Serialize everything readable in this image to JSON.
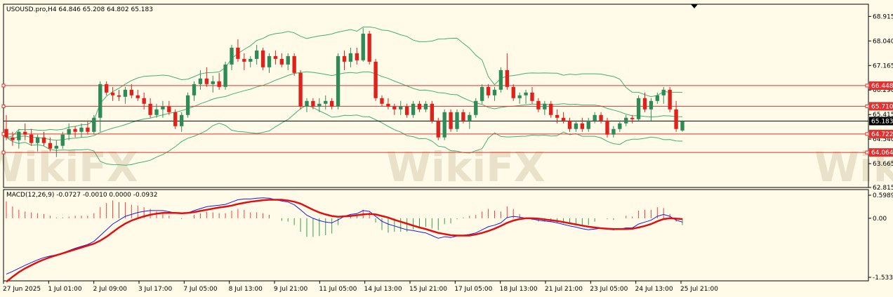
{
  "chart_header": {
    "title": "USOUSD.pro,H4  64.846 65.208 64.802 65.183",
    "macd_title": "MACD(12,26,9) -0.0727 -0.0010 0.0000 -0.0932"
  },
  "watermark": "WikiFX",
  "colors": {
    "background": "#fffbe8",
    "bull": "#2e8b57",
    "bear": "#e0201a",
    "band": "#3cb371",
    "level": "#e03030",
    "macd_line": "#1a1ad8",
    "signal_line": "#e01010",
    "histogram": "#ff3b3b",
    "histogram_neg": "#2ea04a",
    "grid": "#000000"
  },
  "chart_data": [
    {
      "type": "candlestick",
      "title": "USOUSD.pro,H4",
      "y_ticks": [
        "68.915",
        "68.040",
        "67.165",
        "66.290",
        "65.415",
        "64.540",
        "63.665",
        "62.815"
      ],
      "ylim": [
        62.815,
        69.35
      ],
      "x_ticks": [
        "27 Jun 2025",
        "1 Jul 01:00",
        "2 Jul 09:00",
        "3 Jul 17:00",
        "7 Jul 05:00",
        "8 Jul 13:00",
        "9 Jul 21:00",
        "11 Jul 05:00",
        "14 Jul 13:00",
        "15 Jul 21:00",
        "17 Jul 05:00",
        "18 Jul 13:00",
        "21 Jul 21:00",
        "23 Jul 05:00",
        "24 Jul 13:00",
        "25 Jul 21:00"
      ],
      "price_labels": [
        {
          "value": 66.448,
          "label": "66.448",
          "style": "level"
        },
        {
          "value": 65.71,
          "label": "65.710",
          "style": "level"
        },
        {
          "value": 65.183,
          "label": "65.183",
          "style": "current"
        },
        {
          "value": 64.722,
          "label": "64.722",
          "style": "level"
        },
        {
          "value": 64.064,
          "label": "64.064",
          "style": "level"
        }
      ],
      "candles": [
        [
          64.9,
          65.4,
          64.5,
          64.6
        ],
        [
          64.6,
          64.8,
          64.3,
          64.5
        ],
        [
          64.5,
          64.9,
          64.2,
          64.8
        ],
        [
          64.8,
          65.1,
          64.5,
          64.7
        ],
        [
          64.7,
          64.9,
          64.3,
          64.4
        ],
        [
          64.4,
          64.7,
          64.1,
          64.6
        ],
        [
          64.6,
          64.8,
          64.3,
          64.4
        ],
        [
          64.4,
          64.6,
          64.1,
          64.2
        ],
        [
          64.2,
          64.5,
          63.9,
          64.3
        ],
        [
          64.3,
          64.8,
          64.2,
          64.7
        ],
        [
          64.7,
          65.1,
          64.5,
          64.9
        ],
        [
          64.9,
          65.0,
          64.6,
          64.8
        ],
        [
          64.8,
          65.1,
          64.6,
          64.95
        ],
        [
          64.95,
          65.2,
          64.7,
          64.8
        ],
        [
          64.8,
          65.4,
          64.7,
          65.3
        ],
        [
          65.3,
          66.6,
          64.8,
          66.5
        ],
        [
          66.5,
          66.6,
          66.1,
          66.2
        ],
        [
          66.2,
          66.4,
          65.9,
          66.1
        ],
        [
          66.1,
          66.3,
          65.9,
          66.05
        ],
        [
          66.05,
          66.4,
          65.8,
          66.3
        ],
        [
          66.3,
          66.5,
          66.0,
          66.1
        ],
        [
          66.1,
          66.3,
          65.9,
          66.0
        ],
        [
          66.0,
          66.2,
          65.6,
          65.8
        ],
        [
          65.8,
          66.0,
          65.3,
          65.4
        ],
        [
          65.4,
          65.8,
          65.3,
          65.6
        ],
        [
          65.6,
          65.9,
          65.3,
          65.7
        ],
        [
          65.7,
          65.9,
          65.4,
          65.5
        ],
        [
          65.5,
          65.6,
          64.9,
          65.0
        ],
        [
          65.0,
          65.5,
          64.8,
          65.4
        ],
        [
          65.4,
          66.2,
          65.3,
          66.1
        ],
        [
          66.1,
          66.6,
          65.9,
          66.5
        ],
        [
          66.5,
          67.0,
          66.3,
          66.7
        ],
        [
          66.7,
          67.1,
          66.4,
          66.5
        ],
        [
          66.5,
          66.8,
          66.2,
          66.6
        ],
        [
          66.6,
          66.9,
          66.3,
          66.4
        ],
        [
          66.4,
          67.3,
          66.3,
          67.2
        ],
        [
          67.2,
          67.9,
          67.0,
          67.8
        ],
        [
          67.8,
          68.1,
          67.3,
          67.4
        ],
        [
          67.4,
          67.6,
          67.0,
          67.3
        ],
        [
          67.3,
          67.5,
          67.1,
          67.4
        ],
        [
          67.4,
          67.9,
          67.2,
          67.7
        ],
        [
          67.7,
          67.8,
          67.0,
          67.1
        ],
        [
          67.1,
          67.6,
          66.9,
          67.5
        ],
        [
          67.5,
          67.7,
          67.2,
          67.4
        ],
        [
          67.4,
          67.6,
          67.1,
          67.2
        ],
        [
          67.2,
          67.6,
          67.0,
          67.5
        ],
        [
          67.5,
          67.6,
          66.8,
          66.9
        ],
        [
          66.9,
          67.0,
          65.6,
          65.7
        ],
        [
          65.7,
          66.0,
          65.5,
          65.9
        ],
        [
          65.9,
          66.0,
          65.6,
          65.7
        ],
        [
          65.7,
          66.0,
          65.5,
          65.8
        ],
        [
          65.8,
          66.1,
          65.6,
          65.9
        ],
        [
          65.9,
          66.0,
          65.6,
          65.7
        ],
        [
          65.7,
          67.6,
          65.6,
          67.5
        ],
        [
          67.5,
          67.7,
          67.0,
          67.3
        ],
        [
          67.3,
          67.8,
          67.1,
          67.6
        ],
        [
          67.6,
          67.8,
          67.2,
          67.35
        ],
        [
          67.35,
          68.5,
          67.3,
          68.3
        ],
        [
          68.3,
          68.4,
          67.2,
          67.3
        ],
        [
          67.3,
          67.4,
          65.9,
          66.0
        ],
        [
          66.0,
          66.1,
          65.7,
          65.8
        ],
        [
          65.8,
          66.0,
          65.6,
          65.7
        ],
        [
          65.7,
          65.8,
          65.4,
          65.6
        ],
        [
          65.6,
          65.9,
          65.4,
          65.7
        ],
        [
          65.7,
          65.8,
          65.3,
          65.4
        ],
        [
          65.4,
          65.9,
          65.3,
          65.8
        ],
        [
          65.8,
          65.9,
          65.5,
          65.6
        ],
        [
          65.6,
          65.9,
          65.5,
          65.8
        ],
        [
          65.8,
          65.9,
          65.1,
          65.2
        ],
        [
          65.2,
          65.3,
          64.5,
          64.6
        ],
        [
          64.6,
          65.6,
          64.5,
          65.5
        ],
        [
          65.5,
          65.6,
          64.8,
          64.9
        ],
        [
          64.9,
          65.6,
          64.8,
          65.5
        ],
        [
          65.5,
          65.6,
          65.1,
          65.2
        ],
        [
          65.2,
          65.5,
          64.9,
          65.4
        ],
        [
          65.4,
          66.0,
          65.3,
          65.9
        ],
        [
          65.9,
          66.5,
          65.8,
          66.4
        ],
        [
          66.4,
          66.5,
          66.0,
          66.1
        ],
        [
          66.1,
          66.4,
          65.9,
          66.3
        ],
        [
          66.3,
          67.1,
          66.2,
          67.0
        ],
        [
          67.0,
          67.6,
          66.3,
          66.4
        ],
        [
          66.4,
          66.5,
          65.9,
          66.0
        ],
        [
          66.0,
          66.2,
          65.8,
          66.1
        ],
        [
          66.1,
          66.3,
          65.8,
          66.2
        ],
        [
          66.2,
          66.4,
          65.8,
          65.9
        ],
        [
          65.9,
          66.0,
          65.5,
          65.6
        ],
        [
          65.6,
          65.9,
          65.4,
          65.8
        ],
        [
          65.8,
          65.9,
          65.3,
          65.4
        ],
        [
          65.4,
          65.6,
          65.1,
          65.3
        ],
        [
          65.3,
          65.5,
          65.1,
          65.2
        ],
        [
          65.2,
          65.3,
          64.8,
          64.9
        ],
        [
          64.9,
          65.2,
          64.8,
          65.1
        ],
        [
          65.1,
          65.3,
          64.8,
          64.9
        ],
        [
          64.9,
          65.3,
          64.8,
          65.2
        ],
        [
          65.2,
          65.5,
          65.1,
          65.4
        ],
        [
          65.4,
          65.5,
          65.1,
          65.2
        ],
        [
          65.2,
          65.3,
          64.6,
          64.7
        ],
        [
          64.7,
          65.0,
          64.6,
          64.9
        ],
        [
          64.9,
          65.2,
          64.8,
          65.1
        ],
        [
          65.1,
          65.4,
          65.0,
          65.3
        ],
        [
          65.3,
          65.4,
          65.1,
          65.25
        ],
        [
          65.25,
          66.1,
          65.2,
          66.0
        ],
        [
          66.0,
          66.2,
          65.5,
          65.6
        ],
        [
          65.6,
          66.0,
          65.2,
          65.9
        ],
        [
          65.9,
          66.2,
          65.8,
          66.1
        ],
        [
          66.1,
          66.4,
          65.8,
          66.3
        ],
        [
          66.3,
          66.4,
          65.5,
          65.6
        ],
        [
          65.6,
          65.9,
          64.8,
          64.9
        ],
        [
          64.846,
          65.208,
          64.802,
          65.183
        ]
      ]
    },
    {
      "type": "macd",
      "title": "MACD(12,26,9)",
      "y_ticks": [
        "0.5989",
        "0.00",
        "-1.5338"
      ],
      "ylim": [
        -1.5338,
        0.5989
      ],
      "macd": [
        -1.45,
        -1.38,
        -1.3,
        -1.22,
        -1.15,
        -1.08,
        -1.02,
        -0.98,
        -0.95,
        -0.9,
        -0.84,
        -0.78,
        -0.73,
        -0.68,
        -0.6,
        -0.45,
        -0.3,
        -0.15,
        -0.05,
        0.05,
        0.1,
        0.15,
        0.18,
        0.2,
        0.2,
        0.2,
        0.17,
        0.14,
        0.12,
        0.14,
        0.2,
        0.25,
        0.3,
        0.32,
        0.34,
        0.36,
        0.42,
        0.48,
        0.5,
        0.5,
        0.52,
        0.53,
        0.52,
        0.48,
        0.45,
        0.42,
        0.35,
        0.22,
        0.08,
        0.0,
        -0.06,
        -0.1,
        -0.12,
        -0.04,
        0.05,
        0.1,
        0.12,
        0.2,
        0.18,
        0.05,
        -0.08,
        -0.15,
        -0.2,
        -0.25,
        -0.3,
        -0.32,
        -0.35,
        -0.38,
        -0.45,
        -0.52,
        -0.48,
        -0.5,
        -0.46,
        -0.44,
        -0.42,
        -0.38,
        -0.3,
        -0.22,
        -0.18,
        -0.12,
        0.02,
        0.05,
        0.03,
        0.0,
        -0.02,
        -0.05,
        -0.07,
        -0.09,
        -0.12,
        -0.16,
        -0.2,
        -0.23,
        -0.27,
        -0.3,
        -0.28,
        -0.26,
        -0.28,
        -0.3,
        -0.28,
        -0.25,
        -0.25,
        -0.15,
        -0.1,
        -0.05,
        0.05,
        0.1,
        0.05,
        -0.05,
        -0.1
      ],
      "signal": [
        -1.65,
        -1.52,
        -1.4,
        -1.3,
        -1.22,
        -1.14,
        -1.07,
        -1.01,
        -0.96,
        -0.91,
        -0.86,
        -0.81,
        -0.76,
        -0.71,
        -0.66,
        -0.58,
        -0.48,
        -0.36,
        -0.24,
        -0.14,
        -0.06,
        0.0,
        0.05,
        0.09,
        0.12,
        0.14,
        0.14,
        0.14,
        0.13,
        0.14,
        0.16,
        0.19,
        0.22,
        0.25,
        0.28,
        0.3,
        0.33,
        0.37,
        0.4,
        0.43,
        0.45,
        0.47,
        0.48,
        0.48,
        0.48,
        0.46,
        0.43,
        0.38,
        0.3,
        0.22,
        0.15,
        0.1,
        0.06,
        0.04,
        0.05,
        0.06,
        0.08,
        0.1,
        0.11,
        0.1,
        0.06,
        0.02,
        -0.04,
        -0.09,
        -0.14,
        -0.19,
        -0.24,
        -0.28,
        -0.33,
        -0.38,
        -0.41,
        -0.44,
        -0.45,
        -0.45,
        -0.45,
        -0.42,
        -0.38,
        -0.33,
        -0.27,
        -0.2,
        -0.12,
        -0.06,
        -0.02,
        0.0,
        0.0,
        -0.01,
        -0.03,
        -0.05,
        -0.07,
        -0.1,
        -0.13,
        -0.16,
        -0.19,
        -0.22,
        -0.24,
        -0.26,
        -0.27,
        -0.28,
        -0.28,
        -0.28,
        -0.27,
        -0.24,
        -0.2,
        -0.15,
        -0.08,
        -0.02,
        0.0,
        -0.01,
        -0.02
      ]
    }
  ]
}
